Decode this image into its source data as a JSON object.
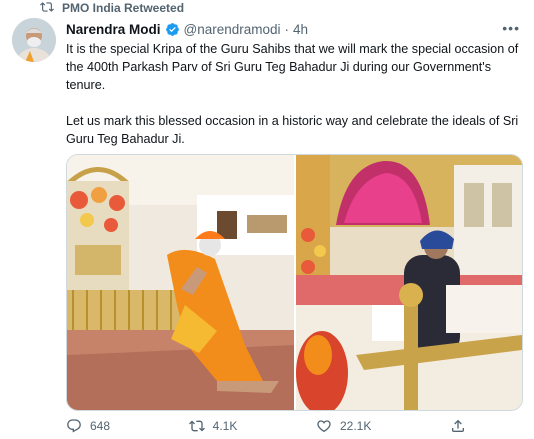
{
  "retweet_banner": {
    "icon": "retweet-icon",
    "text": "PMO India Retweeted"
  },
  "author": {
    "name": "Narendra Modi",
    "handle": "@narendramodi",
    "separator": "·",
    "time": "4h",
    "verified_icon": "verified-badge-icon",
    "avatar": "avatar-photo"
  },
  "tweet": {
    "paragraph1": "It is the special Kripa of the Guru Sahibs that we will mark the special occasion of the 400th Parkash Parv of Sri Guru Teg Bahadur Ji during our Government's tenure.",
    "paragraph2": "Let us mark this blessed occasion in a historic way and celebrate the ideals of Sri Guru Teg Bahadur Ji."
  },
  "actions": {
    "replies": "648",
    "retweets": "4.1K",
    "likes": "22.1K"
  },
  "colors": {
    "accent": "#1d9bf0",
    "muted": "#536471",
    "text": "#0f1419",
    "saffron": "#f28c1a"
  }
}
